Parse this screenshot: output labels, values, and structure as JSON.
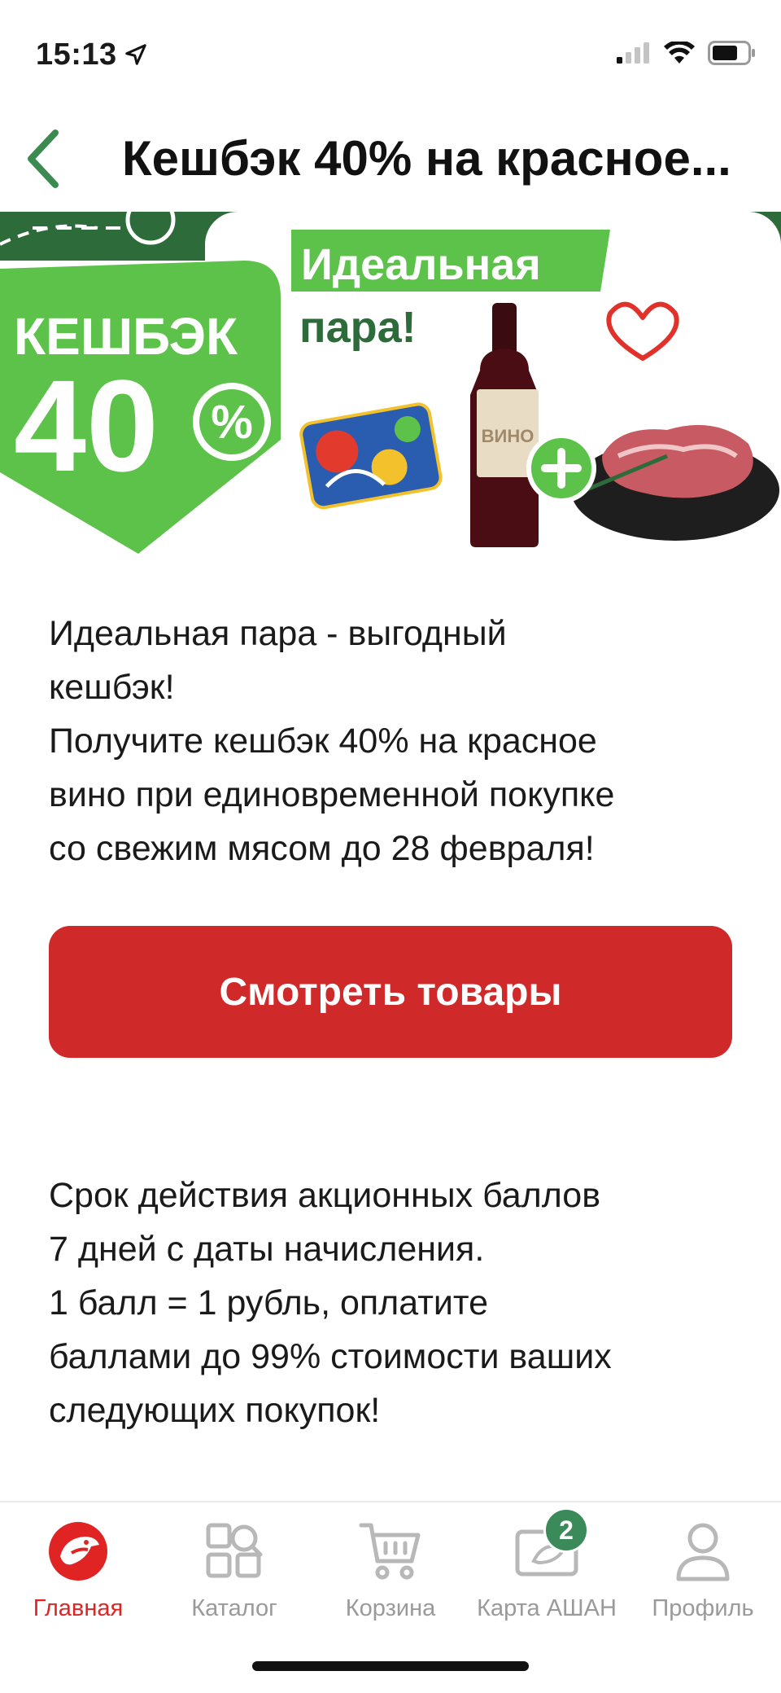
{
  "status_bar": {
    "time": "15:13"
  },
  "header": {
    "title": "Кешбэк 40% на красное..."
  },
  "banner": {
    "cashback_word": "КЕШБЭК",
    "cashback_number": "40",
    "percent_sign": "%",
    "headline_line1": "Идеальная",
    "headline_line2": "пара!",
    "bottle_label": "ВИНО",
    "plus_sign": "+"
  },
  "description": {
    "lines": [
      "Идеальная пара - выгодный",
      "кешбэк!",
      "Получите кешбэк 40% на красное",
      "вино при единовременной покупке",
      "со свежим мясом до 28 февраля!"
    ]
  },
  "cta": {
    "label": "Смотреть товары"
  },
  "terms": {
    "lines": [
      "Срок действия акционных баллов",
      "7 дней с даты начисления.",
      "1 балл = 1 рубль, оплатите",
      "баллами до 99% стоимости ваших",
      "следующих покупок!"
    ]
  },
  "tab_bar": {
    "tabs": [
      {
        "label": "Главная",
        "icon": "auchan-bird-icon",
        "active": true
      },
      {
        "label": "Каталог",
        "icon": "catalog-search-icon",
        "active": false
      },
      {
        "label": "Корзина",
        "icon": "cart-icon",
        "active": false
      },
      {
        "label": "Карта АШАН",
        "icon": "loyalty-card-icon",
        "active": false,
        "badge": "2"
      },
      {
        "label": "Профиль",
        "icon": "profile-icon",
        "active": false
      }
    ]
  },
  "colors": {
    "accent_red": "#d0292a",
    "brand_green": "#5cc24a",
    "dark_green": "#2e6b3a",
    "tab_inactive": "#9a9a9a",
    "badge_green": "#3a8a5a"
  }
}
